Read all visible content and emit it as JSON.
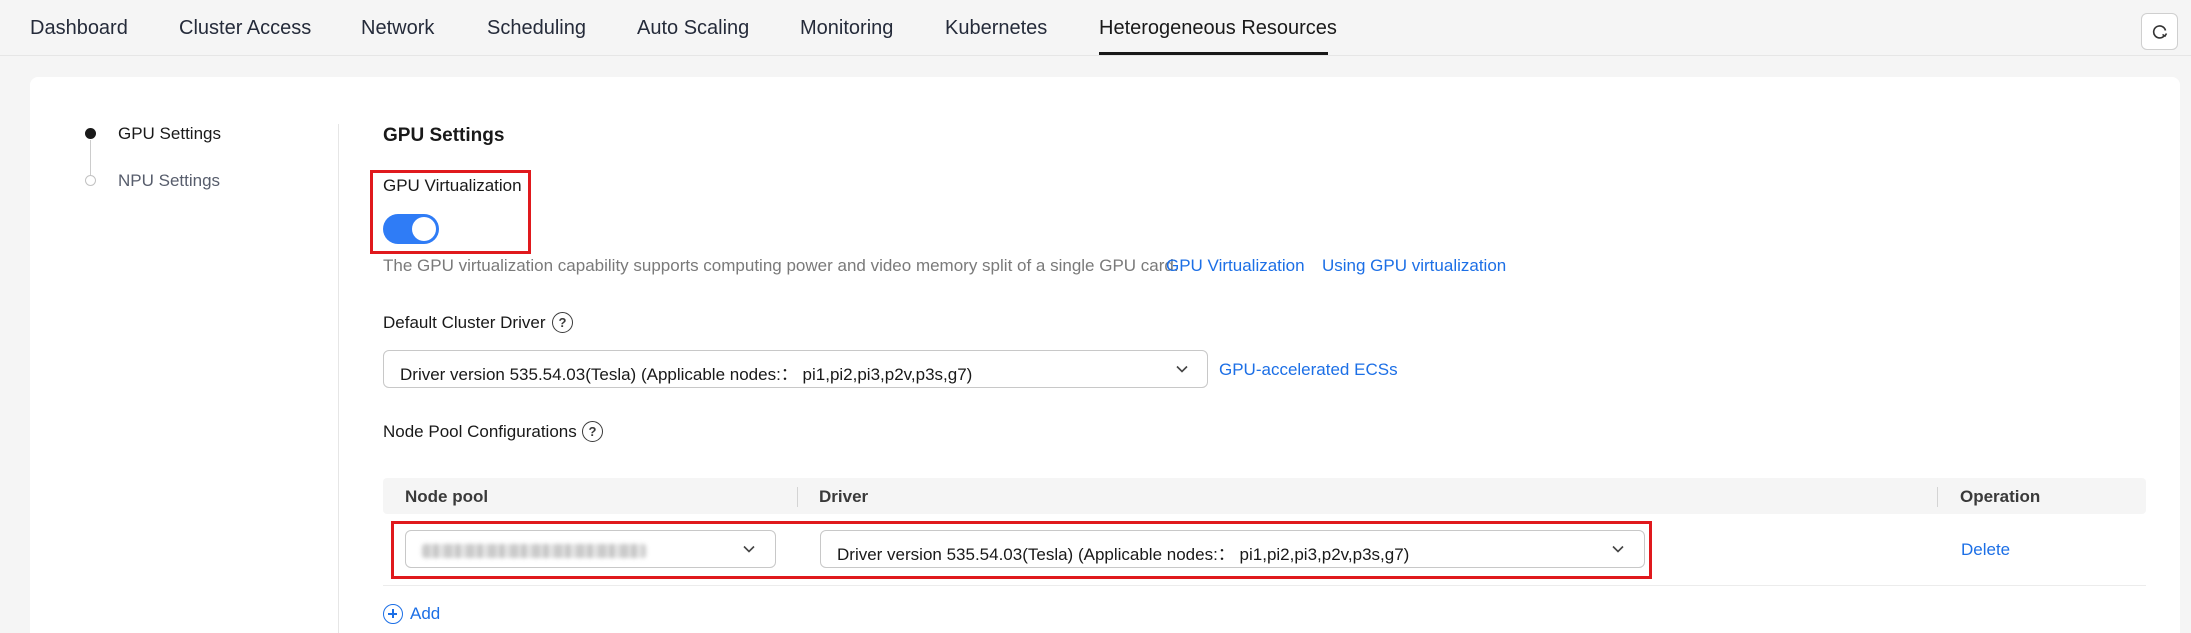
{
  "tabs": [
    {
      "label": "Dashboard"
    },
    {
      "label": "Cluster Access"
    },
    {
      "label": "Network"
    },
    {
      "label": "Scheduling"
    },
    {
      "label": "Auto Scaling"
    },
    {
      "label": "Monitoring"
    },
    {
      "label": "Kubernetes"
    },
    {
      "label": "Heterogeneous Resources",
      "active": true
    }
  ],
  "anchors": [
    {
      "label": "GPU Settings",
      "active": true
    },
    {
      "label": "NPU Settings",
      "active": false
    }
  ],
  "gpu": {
    "section_title": "GPU Settings",
    "virtualization_label": "GPU Virtualization",
    "virtualization_enabled": true,
    "description": "The GPU virtualization capability supports computing power and video memory split of a single GPU card.",
    "link_virtualization": "GPU Virtualization",
    "link_using": "Using GPU virtualization",
    "default_driver_label": "Default Cluster Driver",
    "default_driver_value": "Driver version 535.54.03(Tesla) (Applicable nodes:： pi1,pi2,pi3,p2v,p3s,g7)",
    "link_ecs": "GPU-accelerated ECSs",
    "node_pool_label": "Node Pool Configurations"
  },
  "table": {
    "headers": {
      "node_pool": "Node pool",
      "driver": "Driver",
      "operation": "Operation"
    },
    "rows": [
      {
        "driver": "Driver version 535.54.03(Tesla) (Applicable nodes:： pi1,pi2,pi3,p2v,p3s,g7)",
        "operation": "Delete"
      }
    ],
    "add_label": "Add"
  },
  "colors": {
    "accent": "#1c6fe6",
    "toggle_on": "#2f7cf6",
    "highlight": "#e0191d"
  },
  "icons": {
    "refresh": "refresh-icon",
    "help": "help-icon",
    "chevron": "chevron-down-icon",
    "add": "add-circle-icon"
  }
}
